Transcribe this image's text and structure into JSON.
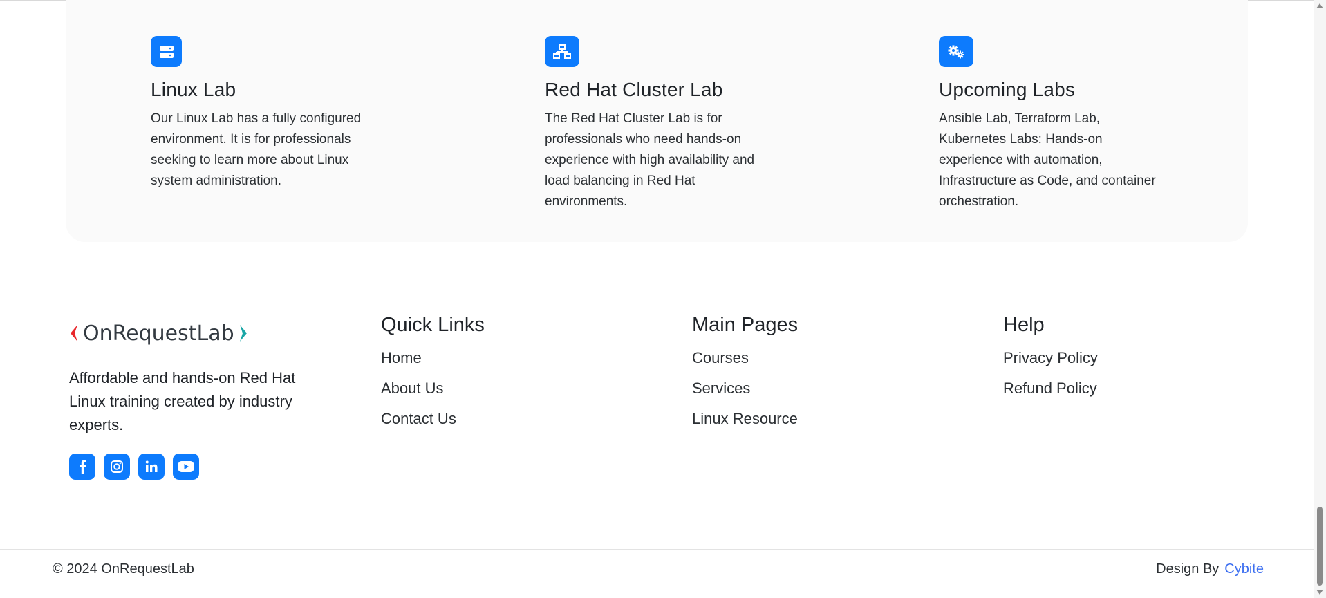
{
  "features": [
    {
      "icon": "server-icon",
      "title": "Linux Lab",
      "text": "Our Linux Lab has a fully configured environment. It is for professionals seeking to learn more about Linux system administration."
    },
    {
      "icon": "network-icon",
      "title": "Red Hat Cluster Lab",
      "text": "The Red Hat Cluster Lab is for professionals who need hands-on experience with high availability and load balancing in Red Hat environments."
    },
    {
      "icon": "gears-icon",
      "title": "Upcoming Labs",
      "text": "Ansible Lab, Terraform Lab, Kubernetes Labs: Hands-on experience with automation, Infrastructure as Code, and container orchestration."
    }
  ],
  "footer": {
    "brand": "OnRequestLab",
    "about": "Affordable and hands-on Red Hat Linux training created by industry experts.",
    "socials": [
      "facebook-icon",
      "instagram-icon",
      "linkedin-icon",
      "youtube-icon"
    ],
    "quick_links": {
      "title": "Quick Links",
      "items": [
        "Home",
        "About Us",
        "Contact Us"
      ]
    },
    "main_pages": {
      "title": "Main Pages",
      "items": [
        "Courses",
        "Services",
        "Linux Resource"
      ]
    },
    "help": {
      "title": "Help",
      "items": [
        "Privacy Policy",
        "Refund Policy"
      ]
    },
    "copyright": "© 2024 OnRequestLab",
    "design_by": "Design By",
    "designer": "Cybite"
  },
  "colors": {
    "accent": "#0d7bfd",
    "link": "#3d6ff0",
    "brand_red": "#e8262b",
    "brand_teal": "#1aa6a6"
  }
}
